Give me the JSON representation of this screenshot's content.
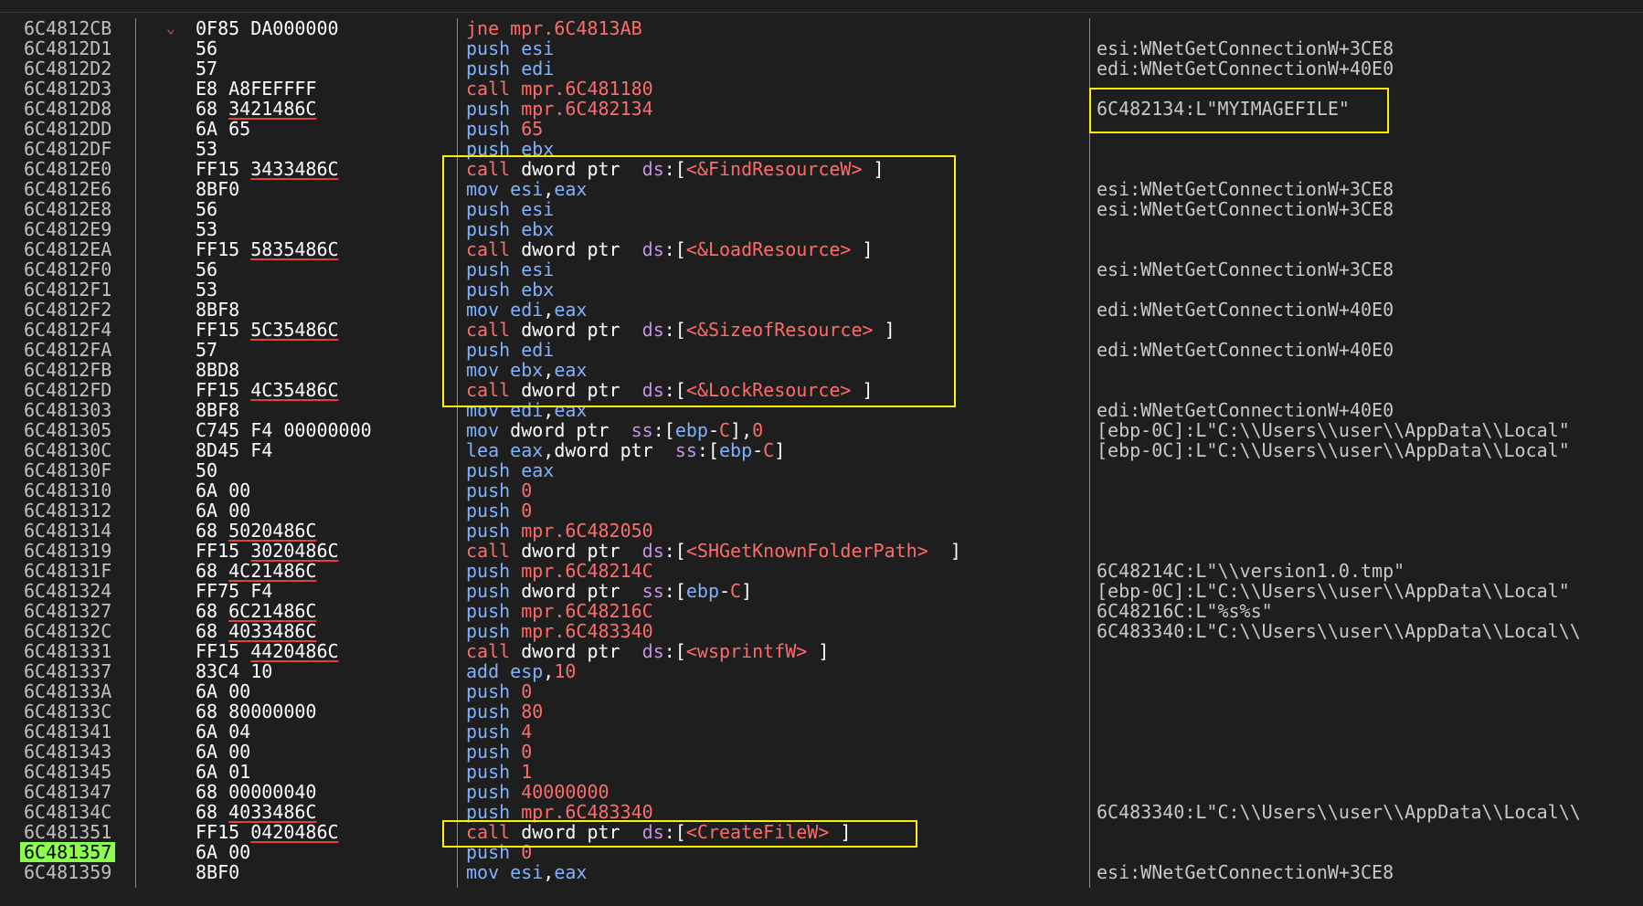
{
  "colors": {
    "background": "#1e1e1e",
    "address": "#c0c0c0",
    "bytes": "#ffffff",
    "mnemonic_call": "#ff6b6b",
    "mnemonic_other": "#7fb2ff",
    "segment": "#c792ea",
    "current_row_highlight": "#8cff4e",
    "annotation_box": "#fff200",
    "comment": "#c8c8c8"
  },
  "current_address": "6C481357",
  "rows": [
    {
      "addr": "6C4812CB",
      "arrow": "⌄",
      "bytes": "0F85 DA000000",
      "bytes_hl": "",
      "instr": [
        [
          "m-jmp",
          "jne "
        ],
        [
          "t-ref",
          "mpr.6C4813AB"
        ]
      ],
      "comment": ""
    },
    {
      "addr": "6C4812D1",
      "arrow": "",
      "bytes": "56",
      "bytes_hl": "",
      "instr": [
        [
          "m-push",
          "push "
        ],
        [
          "t-reg",
          "esi"
        ]
      ],
      "comment": "esi:WNetGetConnectionW+3CE8"
    },
    {
      "addr": "6C4812D2",
      "arrow": "",
      "bytes": "57",
      "bytes_hl": "",
      "instr": [
        [
          "m-push",
          "push "
        ],
        [
          "t-reg",
          "edi"
        ]
      ],
      "comment": "edi:WNetGetConnectionW+40E0"
    },
    {
      "addr": "6C4812D3",
      "arrow": "",
      "bytes": "E8 A8FEFFFF",
      "bytes_hl": "",
      "instr": [
        [
          "m-call",
          "call "
        ],
        [
          "t-ref",
          "mpr.6C481180"
        ]
      ],
      "comment": ""
    },
    {
      "addr": "6C4812D8",
      "arrow": "",
      "bytes": "68 ",
      "bytes_hl": "3421486C",
      "instr": [
        [
          "m-push",
          "push "
        ],
        [
          "t-ref",
          "mpr.6C482134"
        ]
      ],
      "comment": "6C482134:L\"MYIMAGEFILE\""
    },
    {
      "addr": "6C4812DD",
      "arrow": "",
      "bytes": "6A 65",
      "bytes_hl": "",
      "instr": [
        [
          "m-push",
          "push "
        ],
        [
          "t-num",
          "65"
        ]
      ],
      "comment": ""
    },
    {
      "addr": "6C4812DF",
      "arrow": "",
      "bytes": "53",
      "bytes_hl": "",
      "instr": [
        [
          "m-push",
          "push "
        ],
        [
          "t-reg",
          "ebx"
        ]
      ],
      "comment": ""
    },
    {
      "addr": "6C4812E0",
      "arrow": "",
      "bytes": "FF15 ",
      "bytes_hl": "3433486C",
      "instr": [
        [
          "m-call",
          "call "
        ],
        [
          "t-plain",
          "dword ptr  "
        ],
        [
          "t-seg",
          "ds"
        ],
        [
          "t-plain",
          ":["
        ],
        [
          "t-api",
          "<&FindResourceW>"
        ],
        [
          "t-plain",
          " ]"
        ]
      ],
      "comment": ""
    },
    {
      "addr": "6C4812E6",
      "arrow": "",
      "bytes": "8BF0",
      "bytes_hl": "",
      "instr": [
        [
          "m-mov",
          "mov "
        ],
        [
          "t-reg",
          "esi"
        ],
        [
          "t-plain",
          ","
        ],
        [
          "t-reg",
          "eax"
        ]
      ],
      "comment": "esi:WNetGetConnectionW+3CE8"
    },
    {
      "addr": "6C4812E8",
      "arrow": "",
      "bytes": "56",
      "bytes_hl": "",
      "instr": [
        [
          "m-push",
          "push "
        ],
        [
          "t-reg",
          "esi"
        ]
      ],
      "comment": "esi:WNetGetConnectionW+3CE8"
    },
    {
      "addr": "6C4812E9",
      "arrow": "",
      "bytes": "53",
      "bytes_hl": "",
      "instr": [
        [
          "m-push",
          "push "
        ],
        [
          "t-reg",
          "ebx"
        ]
      ],
      "comment": ""
    },
    {
      "addr": "6C4812EA",
      "arrow": "",
      "bytes": "FF15 ",
      "bytes_hl": "5835486C",
      "instr": [
        [
          "m-call",
          "call "
        ],
        [
          "t-plain",
          "dword ptr  "
        ],
        [
          "t-seg",
          "ds"
        ],
        [
          "t-plain",
          ":["
        ],
        [
          "t-api",
          "<&LoadResource>"
        ],
        [
          "t-plain",
          " ]"
        ]
      ],
      "comment": ""
    },
    {
      "addr": "6C4812F0",
      "arrow": "",
      "bytes": "56",
      "bytes_hl": "",
      "instr": [
        [
          "m-push",
          "push "
        ],
        [
          "t-reg",
          "esi"
        ]
      ],
      "comment": "esi:WNetGetConnectionW+3CE8"
    },
    {
      "addr": "6C4812F1",
      "arrow": "",
      "bytes": "53",
      "bytes_hl": "",
      "instr": [
        [
          "m-push",
          "push "
        ],
        [
          "t-reg",
          "ebx"
        ]
      ],
      "comment": ""
    },
    {
      "addr": "6C4812F2",
      "arrow": "",
      "bytes": "8BF8",
      "bytes_hl": "",
      "instr": [
        [
          "m-mov",
          "mov "
        ],
        [
          "t-reg",
          "edi"
        ],
        [
          "t-plain",
          ","
        ],
        [
          "t-reg",
          "eax"
        ]
      ],
      "comment": "edi:WNetGetConnectionW+40E0"
    },
    {
      "addr": "6C4812F4",
      "arrow": "",
      "bytes": "FF15 ",
      "bytes_hl": "5C35486C",
      "instr": [
        [
          "m-call",
          "call "
        ],
        [
          "t-plain",
          "dword ptr  "
        ],
        [
          "t-seg",
          "ds"
        ],
        [
          "t-plain",
          ":["
        ],
        [
          "t-api",
          "<&SizeofResource>"
        ],
        [
          "t-plain",
          " ]"
        ]
      ],
      "comment": ""
    },
    {
      "addr": "6C4812FA",
      "arrow": "",
      "bytes": "57",
      "bytes_hl": "",
      "instr": [
        [
          "m-push",
          "push "
        ],
        [
          "t-reg",
          "edi"
        ]
      ],
      "comment": "edi:WNetGetConnectionW+40E0"
    },
    {
      "addr": "6C4812FB",
      "arrow": "",
      "bytes": "8BD8",
      "bytes_hl": "",
      "instr": [
        [
          "m-mov",
          "mov "
        ],
        [
          "t-reg",
          "ebx"
        ],
        [
          "t-plain",
          ","
        ],
        [
          "t-reg",
          "eax"
        ]
      ],
      "comment": ""
    },
    {
      "addr": "6C4812FD",
      "arrow": "",
      "bytes": "FF15 ",
      "bytes_hl": "4C35486C",
      "instr": [
        [
          "m-call",
          "call "
        ],
        [
          "t-plain",
          "dword ptr  "
        ],
        [
          "t-seg",
          "ds"
        ],
        [
          "t-plain",
          ":["
        ],
        [
          "t-api",
          "<&LockResource>"
        ],
        [
          "t-plain",
          " ]"
        ]
      ],
      "comment": ""
    },
    {
      "addr": "6C481303",
      "arrow": "",
      "bytes": "8BF8",
      "bytes_hl": "",
      "instr": [
        [
          "m-mov",
          "mov "
        ],
        [
          "t-reg",
          "edi"
        ],
        [
          "t-plain",
          ","
        ],
        [
          "t-reg",
          "eax"
        ]
      ],
      "comment": "edi:WNetGetConnectionW+40E0"
    },
    {
      "addr": "6C481305",
      "arrow": "",
      "bytes": "C745 F4 00000000",
      "bytes_hl": "",
      "instr": [
        [
          "m-mov",
          "mov "
        ],
        [
          "t-plain",
          "dword ptr  "
        ],
        [
          "t-seg",
          "ss"
        ],
        [
          "t-plain",
          ":["
        ],
        [
          "t-reg",
          "ebp"
        ],
        [
          "t-plain",
          "-"
        ],
        [
          "t-num",
          "C"
        ],
        [
          "t-plain",
          "],"
        ],
        [
          "t-num",
          "0"
        ]
      ],
      "comment": "[ebp-0C]:L\"C:\\\\Users\\\\user\\\\AppData\\\\Local\""
    },
    {
      "addr": "6C48130C",
      "arrow": "",
      "bytes": "8D45 F4",
      "bytes_hl": "",
      "instr": [
        [
          "m-lea",
          "lea "
        ],
        [
          "t-reg",
          "eax"
        ],
        [
          "t-plain",
          ",dword ptr  "
        ],
        [
          "t-seg",
          "ss"
        ],
        [
          "t-plain",
          ":["
        ],
        [
          "t-reg",
          "ebp"
        ],
        [
          "t-plain",
          "-"
        ],
        [
          "t-num",
          "C"
        ],
        [
          "t-plain",
          "]"
        ]
      ],
      "comment": "[ebp-0C]:L\"C:\\\\Users\\\\user\\\\AppData\\\\Local\""
    },
    {
      "addr": "6C48130F",
      "arrow": "",
      "bytes": "50",
      "bytes_hl": "",
      "instr": [
        [
          "m-push",
          "push "
        ],
        [
          "t-reg",
          "eax"
        ]
      ],
      "comment": ""
    },
    {
      "addr": "6C481310",
      "arrow": "",
      "bytes": "6A 00",
      "bytes_hl": "",
      "instr": [
        [
          "m-push",
          "push "
        ],
        [
          "t-num",
          "0"
        ]
      ],
      "comment": ""
    },
    {
      "addr": "6C481312",
      "arrow": "",
      "bytes": "6A 00",
      "bytes_hl": "",
      "instr": [
        [
          "m-push",
          "push "
        ],
        [
          "t-num",
          "0"
        ]
      ],
      "comment": ""
    },
    {
      "addr": "6C481314",
      "arrow": "",
      "bytes": "68 ",
      "bytes_hl": "5020486C",
      "instr": [
        [
          "m-push",
          "push "
        ],
        [
          "t-ref",
          "mpr.6C482050"
        ]
      ],
      "comment": ""
    },
    {
      "addr": "6C481319",
      "arrow": "",
      "bytes": "FF15 ",
      "bytes_hl": "3020486C",
      "instr": [
        [
          "m-call",
          "call "
        ],
        [
          "t-plain",
          "dword ptr  "
        ],
        [
          "t-seg",
          "ds"
        ],
        [
          "t-plain",
          ":["
        ],
        [
          "t-api",
          "<SHGetKnownFolderPath>"
        ],
        [
          "t-plain",
          "  ]"
        ]
      ],
      "comment": ""
    },
    {
      "addr": "6C48131F",
      "arrow": "",
      "bytes": "68 ",
      "bytes_hl": "4C21486C",
      "instr": [
        [
          "m-push",
          "push "
        ],
        [
          "t-ref",
          "mpr.6C48214C"
        ]
      ],
      "comment": "6C48214C:L\"\\\\version1.0.tmp\""
    },
    {
      "addr": "6C481324",
      "arrow": "",
      "bytes": "FF75 F4",
      "bytes_hl": "",
      "instr": [
        [
          "m-push",
          "push "
        ],
        [
          "t-plain",
          "dword ptr  "
        ],
        [
          "t-seg",
          "ss"
        ],
        [
          "t-plain",
          ":["
        ],
        [
          "t-reg",
          "ebp"
        ],
        [
          "t-plain",
          "-"
        ],
        [
          "t-num",
          "C"
        ],
        [
          "t-plain",
          "]"
        ]
      ],
      "comment": "[ebp-0C]:L\"C:\\\\Users\\\\user\\\\AppData\\\\Local\""
    },
    {
      "addr": "6C481327",
      "arrow": "",
      "bytes": "68 ",
      "bytes_hl": "6C21486C",
      "instr": [
        [
          "m-push",
          "push "
        ],
        [
          "t-ref",
          "mpr.6C48216C"
        ]
      ],
      "comment": "6C48216C:L\"%s%s\""
    },
    {
      "addr": "6C48132C",
      "arrow": "",
      "bytes": "68 ",
      "bytes_hl": "4033486C",
      "instr": [
        [
          "m-push",
          "push "
        ],
        [
          "t-ref",
          "mpr.6C483340"
        ]
      ],
      "comment": "6C483340:L\"C:\\\\Users\\\\user\\\\AppData\\\\Local\\\\"
    },
    {
      "addr": "6C481331",
      "arrow": "",
      "bytes": "FF15 ",
      "bytes_hl": "4420486C",
      "instr": [
        [
          "m-call",
          "call "
        ],
        [
          "t-plain",
          "dword ptr  "
        ],
        [
          "t-seg",
          "ds"
        ],
        [
          "t-plain",
          ":["
        ],
        [
          "t-api",
          "<wsprintfW>"
        ],
        [
          "t-plain",
          " ]"
        ]
      ],
      "comment": ""
    },
    {
      "addr": "6C481337",
      "arrow": "",
      "bytes": "83C4 10",
      "bytes_hl": "",
      "instr": [
        [
          "m-add",
          "add "
        ],
        [
          "t-reg",
          "esp"
        ],
        [
          "t-plain",
          ","
        ],
        [
          "t-num",
          "10"
        ]
      ],
      "comment": ""
    },
    {
      "addr": "6C48133A",
      "arrow": "",
      "bytes": "6A 00",
      "bytes_hl": "",
      "instr": [
        [
          "m-push",
          "push "
        ],
        [
          "t-num",
          "0"
        ]
      ],
      "comment": ""
    },
    {
      "addr": "6C48133C",
      "arrow": "",
      "bytes": "68 80000000",
      "bytes_hl": "",
      "instr": [
        [
          "m-push",
          "push "
        ],
        [
          "t-num",
          "80"
        ]
      ],
      "comment": ""
    },
    {
      "addr": "6C481341",
      "arrow": "",
      "bytes": "6A 04",
      "bytes_hl": "",
      "instr": [
        [
          "m-push",
          "push "
        ],
        [
          "t-num",
          "4"
        ]
      ],
      "comment": ""
    },
    {
      "addr": "6C481343",
      "arrow": "",
      "bytes": "6A 00",
      "bytes_hl": "",
      "instr": [
        [
          "m-push",
          "push "
        ],
        [
          "t-num",
          "0"
        ]
      ],
      "comment": ""
    },
    {
      "addr": "6C481345",
      "arrow": "",
      "bytes": "6A 01",
      "bytes_hl": "",
      "instr": [
        [
          "m-push",
          "push "
        ],
        [
          "t-num",
          "1"
        ]
      ],
      "comment": ""
    },
    {
      "addr": "6C481347",
      "arrow": "",
      "bytes": "68 00000040",
      "bytes_hl": "",
      "instr": [
        [
          "m-push",
          "push "
        ],
        [
          "t-num",
          "40000000"
        ]
      ],
      "comment": ""
    },
    {
      "addr": "6C48134C",
      "arrow": "",
      "bytes": "68 ",
      "bytes_hl": "4033486C",
      "instr": [
        [
          "m-push",
          "push "
        ],
        [
          "t-ref",
          "mpr.6C483340"
        ]
      ],
      "comment": "6C483340:L\"C:\\\\Users\\\\user\\\\AppData\\\\Local\\\\"
    },
    {
      "addr": "6C481351",
      "arrow": "",
      "bytes": "FF15 ",
      "bytes_hl": "0420486C",
      "instr": [
        [
          "m-call",
          "call "
        ],
        [
          "t-plain",
          "dword ptr  "
        ],
        [
          "t-seg",
          "ds"
        ],
        [
          "t-plain",
          ":["
        ],
        [
          "t-api",
          "<CreateFileW>"
        ],
        [
          "t-plain",
          " ]"
        ]
      ],
      "comment": ""
    },
    {
      "addr": "6C481357",
      "arrow": "",
      "bytes": "6A 00",
      "bytes_hl": "",
      "instr": [
        [
          "m-push",
          "push "
        ],
        [
          "t-num",
          "0"
        ]
      ],
      "comment": ""
    },
    {
      "addr": "6C481359",
      "arrow": "",
      "bytes": "8BF0",
      "bytes_hl": "",
      "instr": [
        [
          "m-mov",
          "mov "
        ],
        [
          "t-reg",
          "esi"
        ],
        [
          "t-plain",
          ","
        ],
        [
          "t-reg",
          "eax"
        ]
      ],
      "comment": "esi:WNetGetConnectionW+3CE8"
    }
  ]
}
